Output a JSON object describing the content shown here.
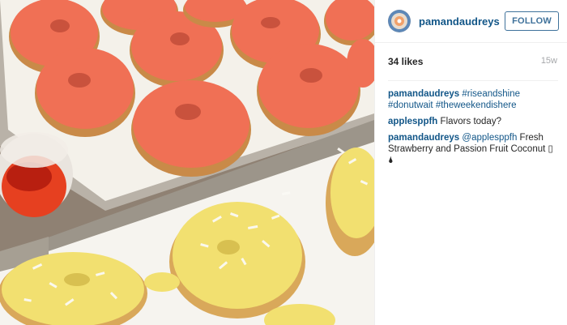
{
  "post": {
    "image_alt": "Trays of donuts with strawberry glaze and passion fruit coconut glaze"
  },
  "header": {
    "username": "pamandaudreys",
    "follow_label": "FOLLOW",
    "avatar_icon": "profile-avatar"
  },
  "meta": {
    "likes": "34 likes",
    "time": "15w"
  },
  "comments": [
    {
      "user": "pamandaudreys",
      "parts": [
        "#riseandshine",
        " ",
        "#donutwait",
        " ",
        "#theweekendishere"
      ]
    },
    {
      "user": "applesppfh",
      "text": "Flavors today?"
    },
    {
      "user": "pamandaudreys",
      "mention": "@applesppfh",
      "text": " Fresh Strawberry and Passion Fruit Coconut ▯🌢"
    }
  ],
  "colors": {
    "link": "#125688",
    "follow": "#3f729b",
    "muted": "#a5a7aa",
    "pink_glaze": "#f07055",
    "yellow_glaze": "#f2e070"
  }
}
